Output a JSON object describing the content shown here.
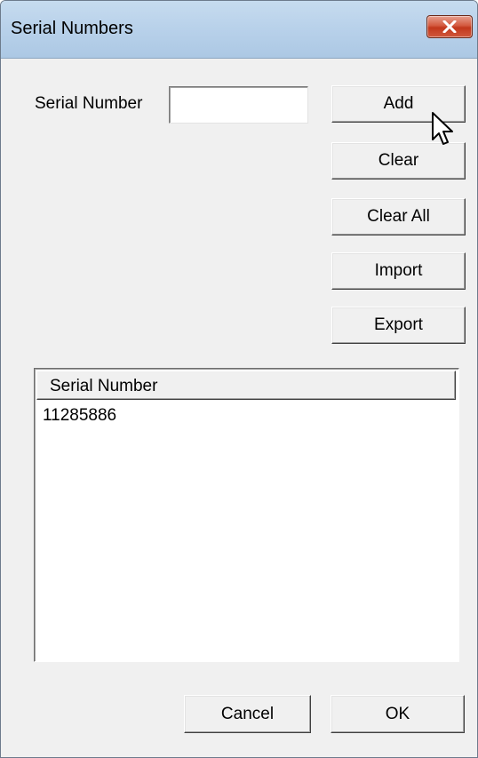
{
  "window": {
    "title": "Serial Numbers"
  },
  "form": {
    "serial_label": "Serial Number",
    "serial_value": "",
    "serial_placeholder": ""
  },
  "buttons": {
    "add": "Add",
    "clear": "Clear",
    "clear_all": "Clear All",
    "import": "Import",
    "export": "Export",
    "cancel": "Cancel",
    "ok": "OK"
  },
  "list": {
    "column_header": "Serial Number",
    "rows": [
      "11285886"
    ]
  },
  "icons": {
    "close": "close-icon",
    "cursor": "mouse-pointer-icon"
  },
  "colors": {
    "dialog_bg": "#f0f0f0",
    "titlebar": "#b8d1ea",
    "close_button": "#c2381c"
  }
}
